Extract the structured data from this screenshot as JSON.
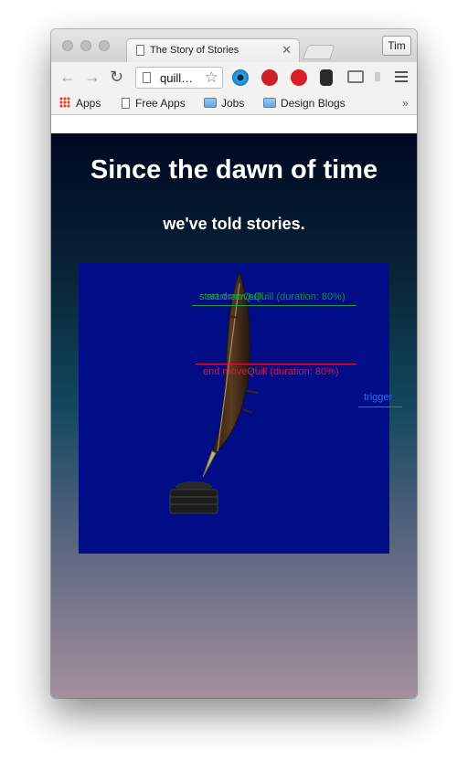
{
  "window": {
    "tab_title": "The Story of Stories",
    "profile_name": "Tim"
  },
  "toolbar": {
    "url": "quill…",
    "back": "←",
    "forward": "→",
    "reload": "↻",
    "star": "☆",
    "tab_close": "✕"
  },
  "bookmarks": [
    {
      "label": "Apps",
      "icon": "apps-grid-icon"
    },
    {
      "label": "Free Apps",
      "icon": "page-icon"
    },
    {
      "label": "Jobs",
      "icon": "folder-icon"
    },
    {
      "label": "Design Blogs",
      "icon": "folder-icon"
    }
  ],
  "bookmarks_overflow": "»",
  "page": {
    "heading": "Since the dawn of time",
    "subheading": "we've told stories."
  },
  "markers": {
    "start_labels": [
      "start drawQuill",
      "start moveQuill (duration: 80%)"
    ],
    "end_label": "end moveQuill (duration: 80%)",
    "trigger_label": "trigger"
  },
  "colors": {
    "stage": "#000d86",
    "start_marker": "#1c9b3c",
    "end_marker": "#e3143c",
    "trigger_marker": "#2e6cf0"
  }
}
